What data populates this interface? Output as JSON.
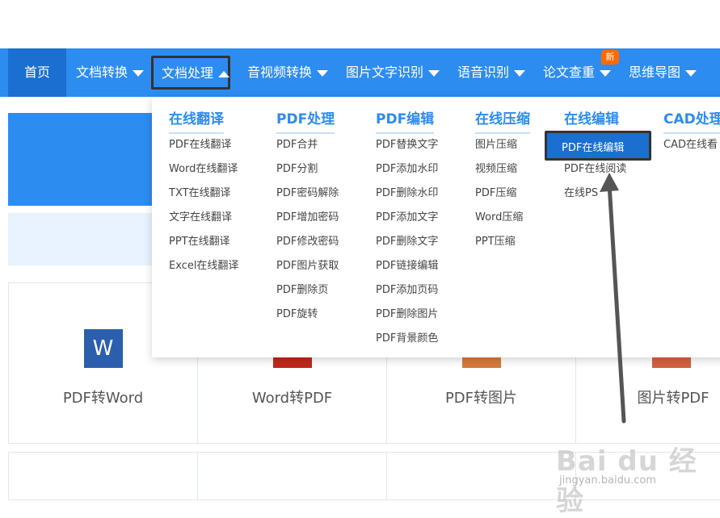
{
  "nav": {
    "home": "首页",
    "items": [
      {
        "label": "文档转换"
      },
      {
        "label": "文档处理"
      },
      {
        "label": "音视频转换"
      },
      {
        "label": "图片文字识别"
      },
      {
        "label": "语音识别"
      },
      {
        "label": "论文查重"
      },
      {
        "label": "思维导图"
      }
    ],
    "badge": "新"
  },
  "dropdown": {
    "columns": [
      {
        "title": "在线翻译",
        "items": [
          "PDF在线翻译",
          "Word在线翻译",
          "TXT在线翻译",
          "文字在线翻译",
          "PPT在线翻译",
          "Excel在线翻译"
        ]
      },
      {
        "title": "PDF处理",
        "items": [
          "PDF合并",
          "PDF分割",
          "PDF密码解除",
          "PDF增加密码",
          "PDF修改密码",
          "PDF图片获取",
          "PDF删除页",
          "PDF旋转"
        ]
      },
      {
        "title": "PDF编辑",
        "items": [
          "PDF替换文字",
          "PDF添加水印",
          "PDF删除水印",
          "PDF添加文字",
          "PDF删除文字",
          "PDF链接编辑",
          "PDF添加页码",
          "PDF删除图片",
          "PDF背景颜色"
        ]
      },
      {
        "title": "在线压缩",
        "items": [
          "图片压缩",
          "视频压缩",
          "PDF压缩",
          "Word压缩",
          "PPT压缩"
        ]
      },
      {
        "title": "在线编辑",
        "items": [
          "PDF在线编辑",
          "PDF在线阅读",
          "在线PS"
        ]
      },
      {
        "title": "CAD处理",
        "items": [
          "CAD在线看"
        ]
      }
    ]
  },
  "tools": [
    {
      "label": "PDF转Word",
      "icon": "W",
      "color": "#2b5fad"
    },
    {
      "label": "Word转PDF",
      "icon": "",
      "color": "#c0281b"
    },
    {
      "label": "PDF转图片",
      "icon": "",
      "color": "#d67a3c"
    },
    {
      "label": "图片转PDF",
      "icon": "",
      "color": "#d4613e"
    }
  ],
  "watermark": {
    "brand": "Bai du 经验",
    "url": "jingyan.baidu.com"
  }
}
